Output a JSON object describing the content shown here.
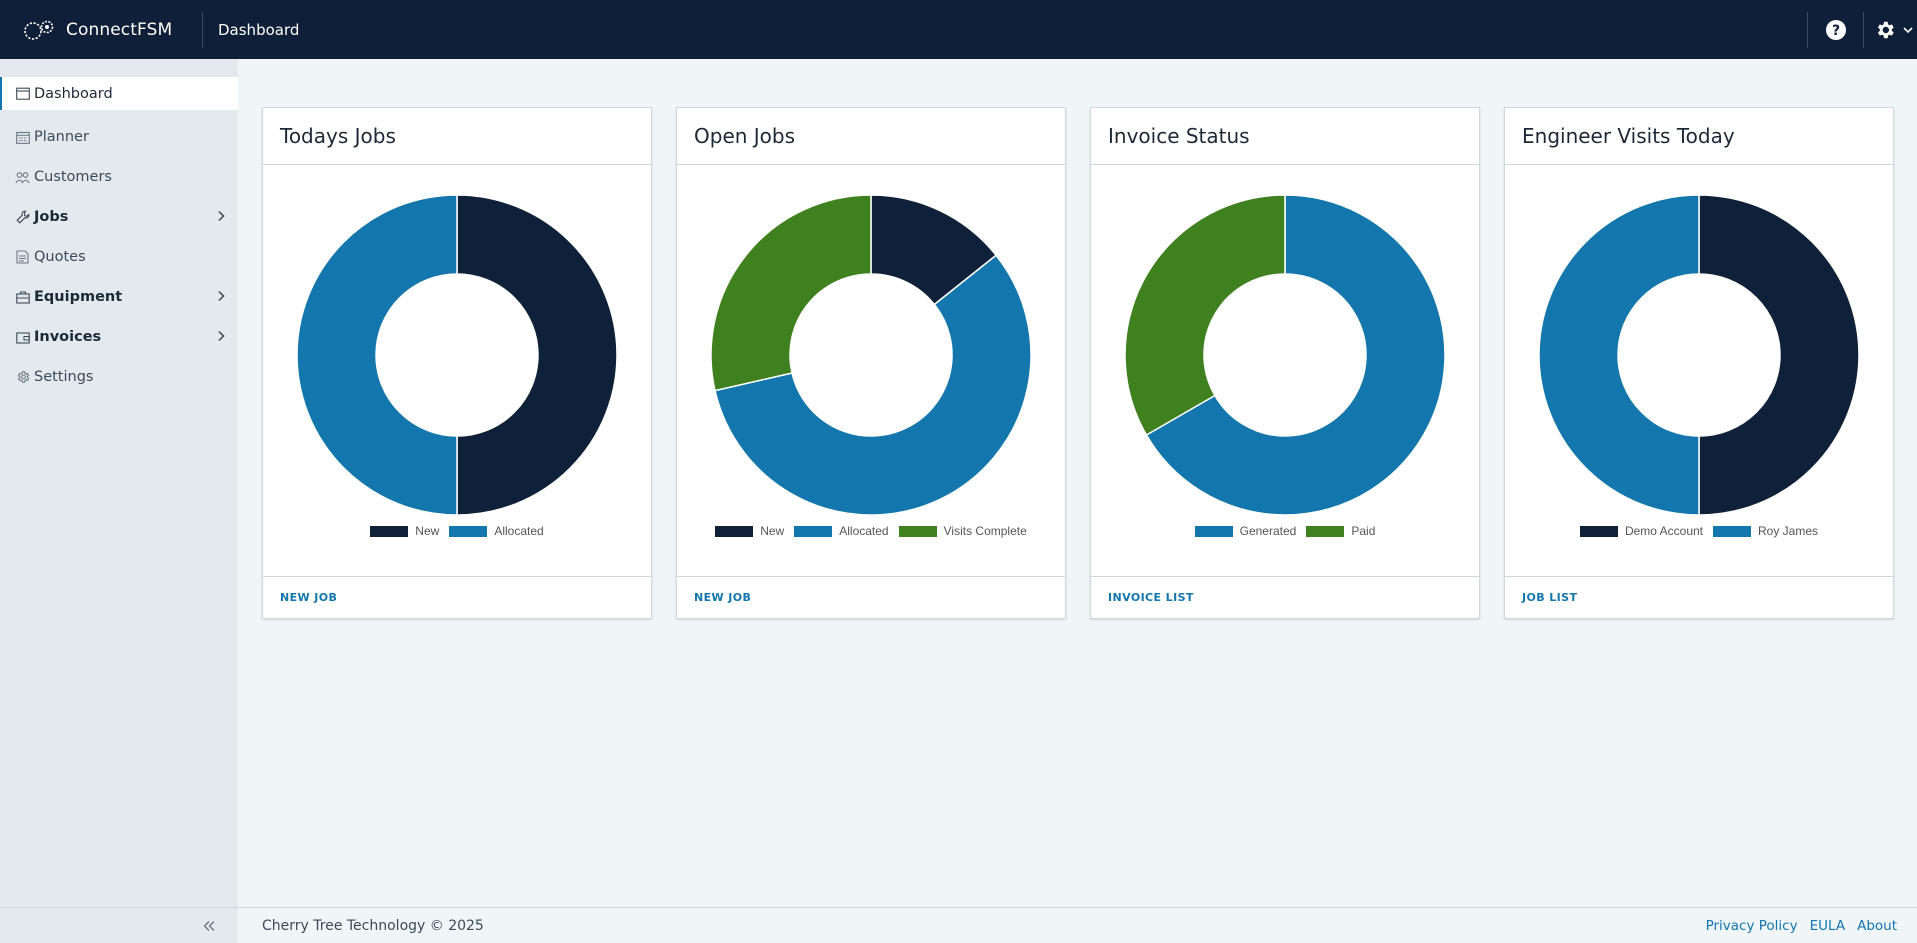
{
  "app": {
    "name": "ConnectFSM",
    "page_title": "Dashboard"
  },
  "colors": {
    "navy": "#0f2039",
    "blue": "#1376ad",
    "green": "#40811f",
    "header_bg": "#0f1f38",
    "link": "#1376ad"
  },
  "header": {
    "icons": [
      "help-icon",
      "gear-icon",
      "chevron-down-icon"
    ]
  },
  "sidebar": {
    "items": [
      {
        "label": "Dashboard",
        "icon": "calendar-icon"
      },
      {
        "label": "Planner",
        "icon": "planner-icon"
      },
      {
        "label": "Customers",
        "icon": "users-icon"
      },
      {
        "label": "Jobs",
        "icon": "wrench-icon"
      },
      {
        "label": "Quotes",
        "icon": "document-icon"
      },
      {
        "label": "Equipment",
        "icon": "briefcase-icon"
      },
      {
        "label": "Invoices",
        "icon": "wallet-icon"
      },
      {
        "label": "Settings",
        "icon": "cog-icon"
      }
    ]
  },
  "cards": [
    {
      "title": "Todays Jobs",
      "footer_link": "NEW JOB"
    },
    {
      "title": "Open Jobs",
      "footer_link": "NEW JOB"
    },
    {
      "title": "Invoice Status",
      "footer_link": "INVOICE LIST"
    },
    {
      "title": "Engineer Visits Today",
      "footer_link": "JOB LIST"
    }
  ],
  "chart_data": [
    {
      "type": "pie",
      "title": "Todays Jobs",
      "categories": [
        "New",
        "Allocated"
      ],
      "values": [
        1,
        1
      ],
      "colors": [
        "#0f2039",
        "#1376ad"
      ],
      "legend": "bottom"
    },
    {
      "type": "pie",
      "title": "Open Jobs",
      "categories": [
        "New",
        "Allocated",
        "Visits Complete"
      ],
      "values": [
        1,
        4,
        2
      ],
      "colors": [
        "#0f2039",
        "#1376ad",
        "#40811f"
      ],
      "legend": "bottom"
    },
    {
      "type": "pie",
      "title": "Invoice Status",
      "categories": [
        "Generated",
        "Paid"
      ],
      "values": [
        2,
        1
      ],
      "colors": [
        "#1376ad",
        "#40811f"
      ],
      "legend": "bottom"
    },
    {
      "type": "pie",
      "title": "Engineer Visits Today",
      "categories": [
        "Demo Account",
        "Roy James"
      ],
      "values": [
        1,
        1
      ],
      "colors": [
        "#0f2039",
        "#1376ad"
      ],
      "legend": "bottom"
    }
  ],
  "footer": {
    "copyright": "Cherry Tree Technology © 2025",
    "links": [
      "Privacy Policy",
      "EULA",
      "About"
    ]
  }
}
